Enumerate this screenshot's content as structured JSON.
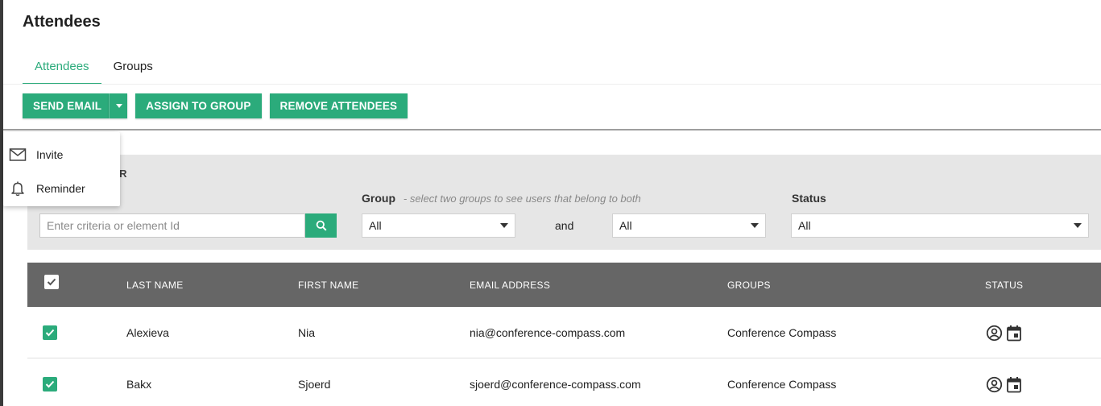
{
  "page": {
    "title": "Attendees"
  },
  "tabs": [
    {
      "label": "Attendees",
      "active": true
    },
    {
      "label": "Groups",
      "active": false
    }
  ],
  "toolbar": {
    "send_email": "SEND EMAIL",
    "assign_to_group": "ASSIGN TO GROUP",
    "remove_attendees": "REMOVE ATTENDEES"
  },
  "send_email_menu": {
    "items": [
      {
        "label": "Invite",
        "icon": "mail-icon"
      },
      {
        "label": "Reminder",
        "icon": "bell-icon"
      }
    ]
  },
  "filter": {
    "title": "ER",
    "search_placeholder": "Enter criteria or element Id",
    "group_label": "Group",
    "group_hint": "-  select two groups to see users that belong to both",
    "group1_value": "All",
    "and_text": "and",
    "group2_value": "All",
    "status_label": "Status",
    "status_value": "All"
  },
  "table": {
    "columns": [
      "LAST NAME",
      "FIRST NAME",
      "EMAIL ADDRESS",
      "GROUPS",
      "STATUS"
    ],
    "rows": [
      {
        "last_name": "Alexieva",
        "first_name": "Nia",
        "email": "nia@conference-compass.com",
        "groups": "Conference Compass",
        "checked": true
      },
      {
        "last_name": "Bakx",
        "first_name": "Sjoerd",
        "email": "sjoerd@conference-compass.com",
        "groups": "Conference Compass",
        "checked": true
      }
    ]
  },
  "colors": {
    "accent": "#2bab7b",
    "header_bg": "#666666",
    "filter_bg": "#e6e6e6"
  }
}
